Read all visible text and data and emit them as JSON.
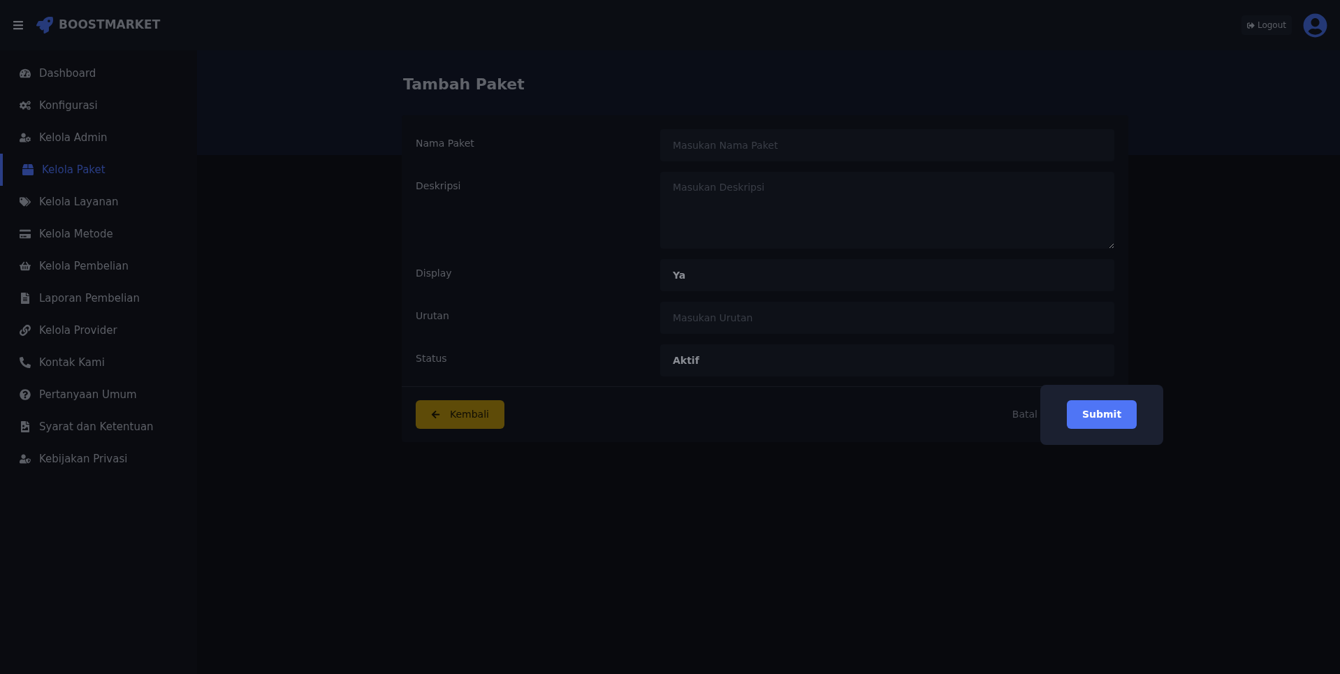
{
  "header": {
    "brand": "BOOSTMARKET",
    "logout": "Logout"
  },
  "sidebar": {
    "items": [
      {
        "label": "Dashboard",
        "selected": false
      },
      {
        "label": "Konfigurasi",
        "selected": false
      },
      {
        "label": "Kelola Admin",
        "selected": false
      },
      {
        "label": "Kelola Paket",
        "selected": true
      },
      {
        "label": "Kelola Layanan",
        "selected": false
      },
      {
        "label": "Kelola Metode",
        "selected": false
      },
      {
        "label": "Kelola Pembelian",
        "selected": false
      },
      {
        "label": "Laporan Pembelian",
        "selected": false
      },
      {
        "label": "Kelola Provider",
        "selected": false
      },
      {
        "label": "Kontak Kami",
        "selected": false
      },
      {
        "label": "Pertanyaan Umum",
        "selected": false
      },
      {
        "label": "Syarat dan Ketentuan",
        "selected": false
      },
      {
        "label": "Kebijakan Privasi",
        "selected": false
      }
    ]
  },
  "page": {
    "title": "Tambah Paket"
  },
  "form": {
    "fields": [
      {
        "label": "Nama Paket",
        "kind": "text",
        "placeholder": "Masukan Nama Paket"
      },
      {
        "label": "Deskripsi",
        "kind": "textarea",
        "placeholder": "Masukan Deskripsi"
      },
      {
        "label": "Display",
        "kind": "select",
        "value": "Ya"
      },
      {
        "label": "Urutan",
        "kind": "text",
        "placeholder": "Masukan Urutan"
      },
      {
        "label": "Status",
        "kind": "select",
        "value": "Aktif"
      }
    ],
    "back_button": "Kembali",
    "cancel_button": "Batal",
    "submit_button": "Submit"
  }
}
